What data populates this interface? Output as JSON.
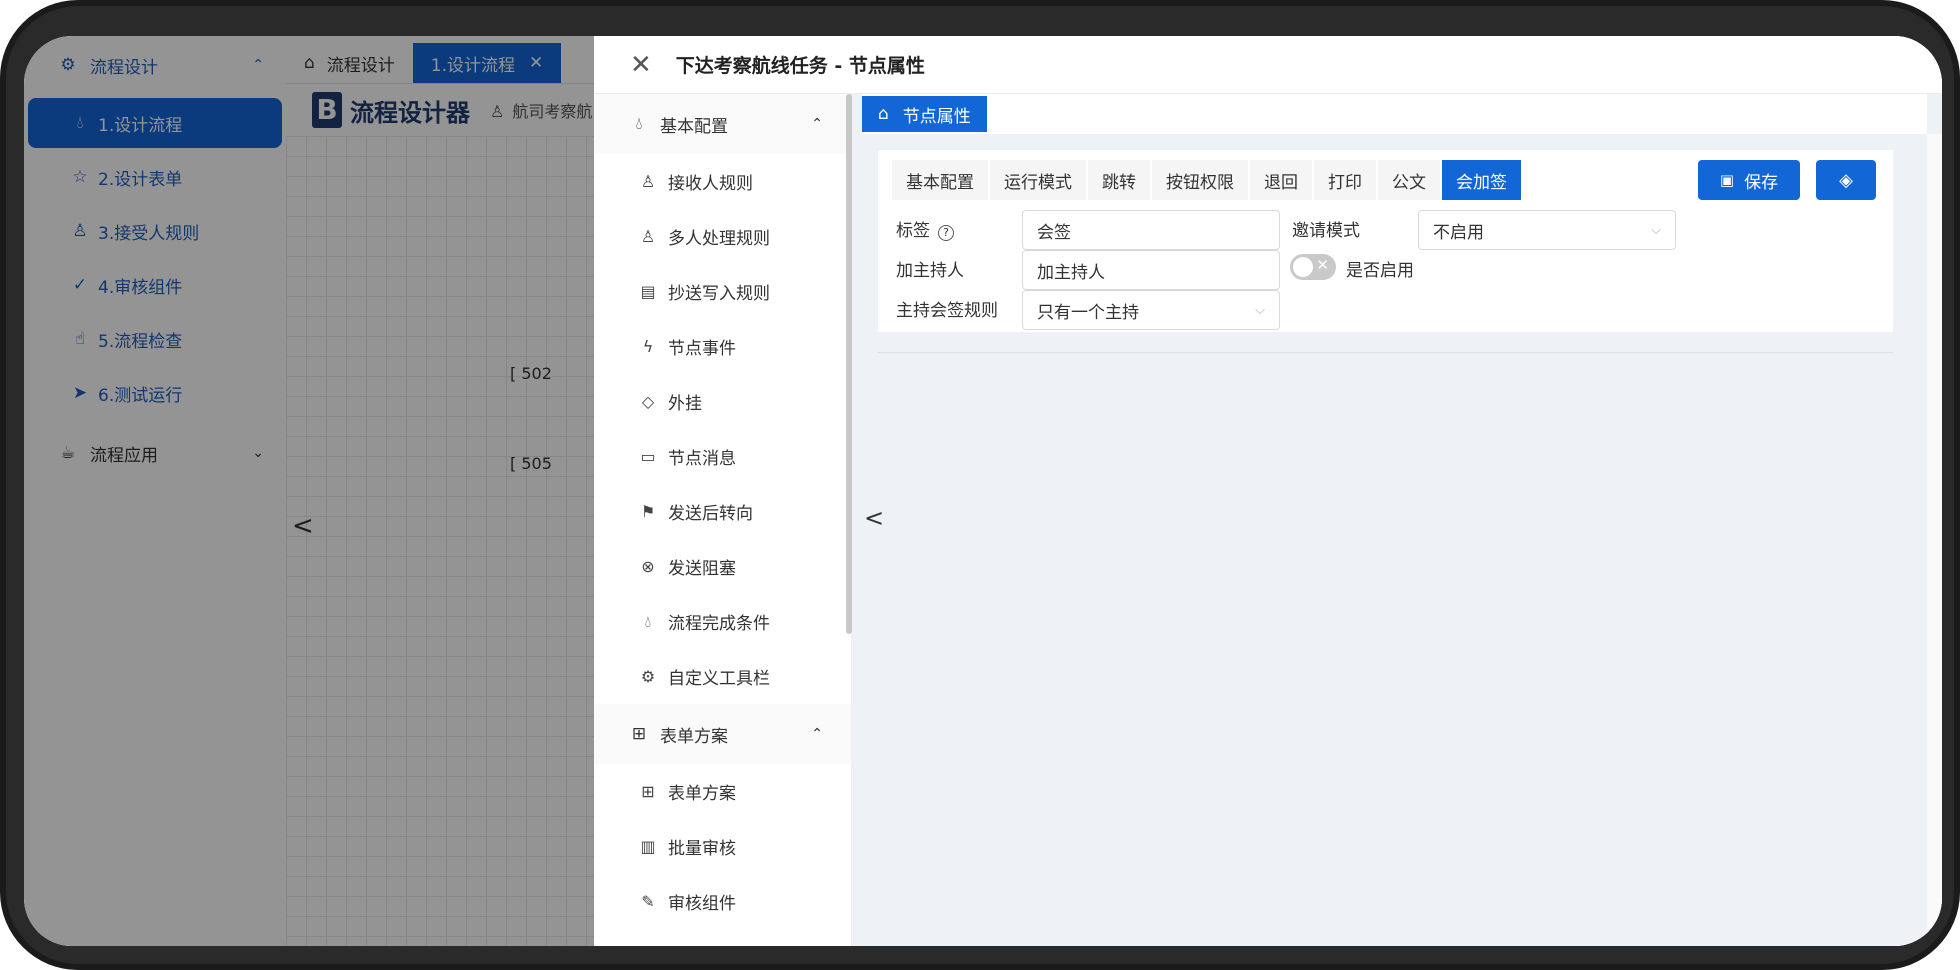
{
  "sidebar": {
    "group_design": "流程设计",
    "items": [
      {
        "label": "1.设计流程"
      },
      {
        "label": "2.设计表单"
      },
      {
        "label": "3.接受人规则"
      },
      {
        "label": "4.审核组件"
      },
      {
        "label": "5.流程检查"
      },
      {
        "label": "6.测试运行"
      }
    ],
    "group_app": "流程应用"
  },
  "tabs": {
    "home": "流程设计",
    "active": "1.设计流程"
  },
  "designer": {
    "logo_letter": "B",
    "title": "流程设计器",
    "subtitle": "航司考察航"
  },
  "canvas": {
    "node1": "[ 502",
    "node2": "[ 505"
  },
  "drawer": {
    "title": "下达考察航线任务 - 节点属性",
    "menu": {
      "group1": "基本配置",
      "items1": [
        "接收人规则",
        "多人处理规则",
        "抄送写入规则",
        "节点事件",
        "外挂",
        "节点消息",
        "发送后转向",
        "发送阻塞",
        "流程完成条件",
        "自定义工具栏"
      ],
      "group2": "表单方案",
      "items2": [
        "表单方案",
        "批量审核",
        "审核组件"
      ]
    },
    "crumb": "节点属性",
    "panel_tabs": [
      "基本配置",
      "运行模式",
      "跳转",
      "按钮权限",
      "退回",
      "打印",
      "公文",
      "会加签"
    ],
    "save_label": "保存",
    "form": {
      "tag_label": "标签",
      "tag_value": "会签",
      "invite_label": "邀请模式",
      "invite_value": "不启用",
      "host_label": "加主持人",
      "host_value": "加主持人",
      "enable_label": "是否启用",
      "rule_label": "主持会签规则",
      "rule_value": "只有一个主持"
    }
  }
}
